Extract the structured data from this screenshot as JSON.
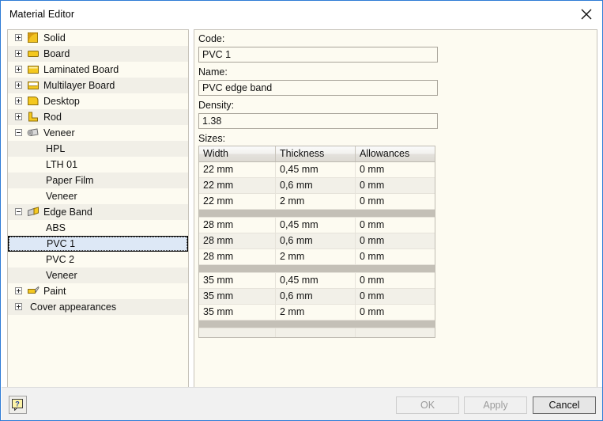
{
  "window": {
    "title": "Material Editor",
    "close_icon": "close-icon",
    "accent_border": "#2e7cd6"
  },
  "tree": {
    "items": [
      {
        "label": "Solid",
        "level": 0,
        "expander": "plus",
        "icon": "solid-material-icon"
      },
      {
        "label": "Board",
        "level": 0,
        "expander": "plus",
        "icon": "board-material-icon"
      },
      {
        "label": "Laminated Board",
        "level": 0,
        "expander": "plus",
        "icon": "laminated-board-icon"
      },
      {
        "label": "Multilayer Board",
        "level": 0,
        "expander": "plus",
        "icon": "multilayer-board-icon"
      },
      {
        "label": "Desktop",
        "level": 0,
        "expander": "plus",
        "icon": "desktop-material-icon"
      },
      {
        "label": "Rod",
        "level": 0,
        "expander": "plus",
        "icon": "rod-material-icon"
      },
      {
        "label": "Veneer",
        "level": 0,
        "expander": "minus",
        "icon": "veneer-roll-icon"
      },
      {
        "label": "HPL",
        "level": 1,
        "expander": "none",
        "icon": "none"
      },
      {
        "label": "LTH 01",
        "level": 1,
        "expander": "none",
        "icon": "none"
      },
      {
        "label": "Paper Film",
        "level": 1,
        "expander": "none",
        "icon": "none"
      },
      {
        "label": "Veneer",
        "level": 1,
        "expander": "none",
        "icon": "none"
      },
      {
        "label": "Edge Band",
        "level": 0,
        "expander": "minus",
        "icon": "edge-band-icon"
      },
      {
        "label": "ABS",
        "level": 1,
        "expander": "none",
        "icon": "none"
      },
      {
        "label": "PVC 1",
        "level": 1,
        "expander": "none",
        "icon": "none",
        "selected": true
      },
      {
        "label": "PVC 2",
        "level": 1,
        "expander": "none",
        "icon": "none"
      },
      {
        "label": "Veneer",
        "level": 1,
        "expander": "none",
        "icon": "none"
      },
      {
        "label": "Paint",
        "level": 0,
        "expander": "plus",
        "icon": "paint-brush-icon"
      },
      {
        "label": "Cover appearances",
        "level": 0,
        "expander": "plus",
        "icon": "none"
      }
    ]
  },
  "detail": {
    "code_label": "Code:",
    "code_value": "PVC 1",
    "name_label": "Name:",
    "name_value": "PVC edge band",
    "density_label": "Density:",
    "density_value": "1.38",
    "sizes_label": "Sizes:"
  },
  "sizes_table": {
    "columns": [
      "Width",
      "Thickness",
      "Allowances"
    ],
    "groups": [
      {
        "rows": [
          [
            "22 mm",
            "0,45 mm",
            "0 mm"
          ],
          [
            "22 mm",
            "0,6 mm",
            "0 mm"
          ],
          [
            "22 mm",
            "2 mm",
            "0 mm"
          ]
        ]
      },
      {
        "rows": [
          [
            "28 mm",
            "0,45 mm",
            "0 mm"
          ],
          [
            "28 mm",
            "0,6 mm",
            "0 mm"
          ],
          [
            "28 mm",
            "2 mm",
            "0 mm"
          ]
        ]
      },
      {
        "rows": [
          [
            "35 mm",
            "0,45 mm",
            "0 mm"
          ],
          [
            "35 mm",
            "0,6 mm",
            "0 mm"
          ],
          [
            "35 mm",
            "2 mm",
            "0 mm"
          ]
        ]
      },
      {
        "rows": [
          [
            "",
            "",
            ""
          ]
        ]
      }
    ]
  },
  "footer": {
    "help_icon": "help-icon",
    "buttons": [
      {
        "label": "OK",
        "enabled": false
      },
      {
        "label": "Apply",
        "enabled": false
      },
      {
        "label": "Cancel",
        "enabled": true
      }
    ]
  }
}
